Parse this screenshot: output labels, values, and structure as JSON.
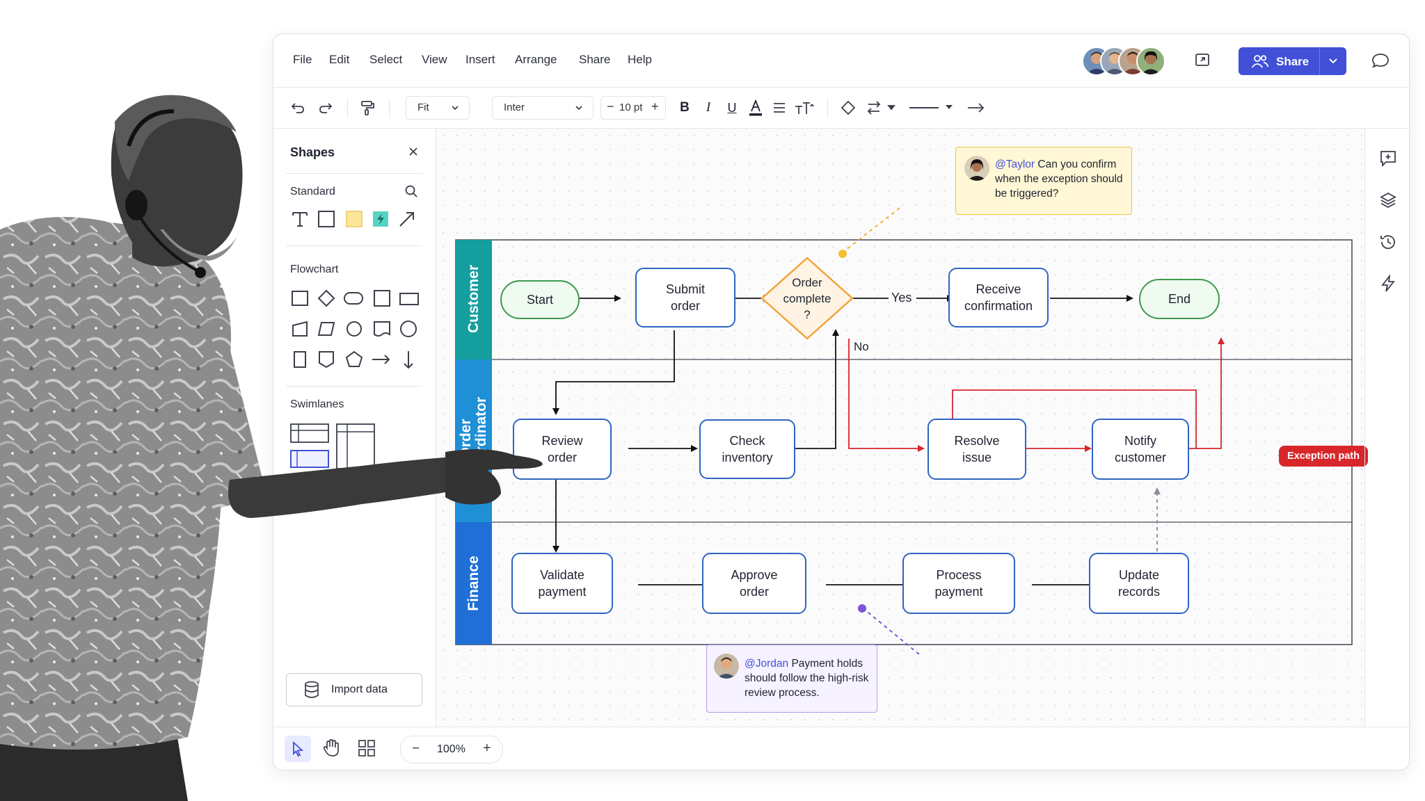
{
  "menu": [
    "File",
    "Edit",
    "Select",
    "View",
    "Insert",
    "Arrange",
    "Share",
    "Help"
  ],
  "header": {
    "share_label": "Share"
  },
  "toolbar": {
    "fit_label": "Fit",
    "font_label": "Inter",
    "size_label": "10 pt"
  },
  "panel": {
    "title": "Shapes",
    "standard_label": "Standard",
    "flowchart_label": "Flowchart",
    "swimlanes_label": "Swimlanes",
    "import_label": "Import data"
  },
  "zoom": {
    "value": "100%"
  },
  "lanes": [
    "Customer",
    "Order\nCoordinator",
    "Finance"
  ],
  "nodes": {
    "start": "Start",
    "submit": "Submit\norder",
    "decision": "Order\ncomplete\n?",
    "receive": "Receive\nconfirmation",
    "end": "End",
    "review": "Review\norder",
    "check": "Check\ninventory",
    "resolve": "Resolve\nissue",
    "notify": "Notify\ncustomer",
    "validate": "Validate\npayment",
    "approve": "Approve\norder",
    "process": "Process\npayment",
    "update": "Update\nrecords"
  },
  "edges": {
    "yes": "Yes",
    "no": "No",
    "exception": "Exception path"
  },
  "comments": {
    "taylor": {
      "mention": "@Taylor",
      "text": " Can you confirm when the exception should be triggered?"
    },
    "jordan": {
      "mention": "@Jordan",
      "text": " Payment holds should follow the high-risk review process."
    }
  },
  "colors": {
    "accent": "#4150d6",
    "lane_customer": "#159e9e",
    "lane_coordinator": "#1f8fd6",
    "lane_finance": "#1f6fd6",
    "exception": "#d8262b",
    "decision": "#f2a33a"
  }
}
